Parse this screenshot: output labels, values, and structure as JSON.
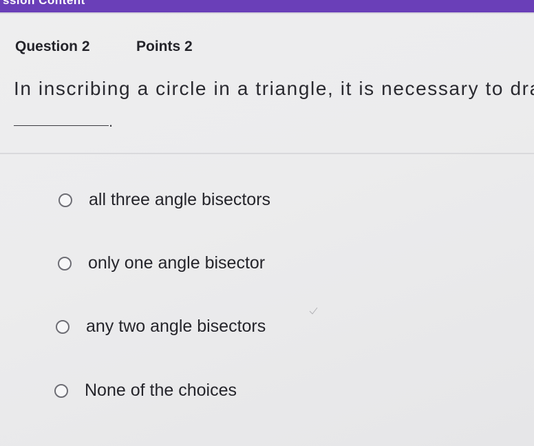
{
  "top_bar": {
    "title": "ssion Content",
    "color": "#6a3fb8"
  },
  "question": {
    "label": "Question 2",
    "points": "Points 2",
    "prompt": "In inscribing a circle in a triangle, it is necessary to draw",
    "blank_period": "."
  },
  "options": [
    {
      "label": "all three angle bisectors",
      "selected": false
    },
    {
      "label": "only one angle bisector",
      "selected": false
    },
    {
      "label": "any two angle bisectors",
      "selected": false
    },
    {
      "label": "None of the choices",
      "selected": false
    }
  ]
}
